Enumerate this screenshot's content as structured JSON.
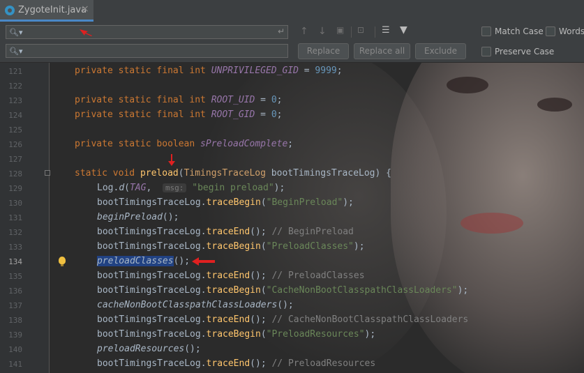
{
  "tab": {
    "filename": "ZygoteInit.java",
    "close": "×"
  },
  "find": {
    "search_placeholder": "",
    "replace_placeholder": "",
    "buttons": {
      "replace": "Replace",
      "replace_all": "Replace all",
      "exclude": "Exclude"
    },
    "options": {
      "match_case": "Match Case",
      "words": "Words",
      "preserve_case": "Preserve Case"
    }
  },
  "editor": {
    "current_line": 134,
    "lines": [
      {
        "n": "121"
      },
      {
        "n": "122"
      },
      {
        "n": "123"
      },
      {
        "n": "124"
      },
      {
        "n": "125"
      },
      {
        "n": "126"
      },
      {
        "n": "127"
      },
      {
        "n": "128"
      },
      {
        "n": "129"
      },
      {
        "n": "130"
      },
      {
        "n": "131"
      },
      {
        "n": "132"
      },
      {
        "n": "133"
      },
      {
        "n": "134"
      },
      {
        "n": "135"
      },
      {
        "n": "136"
      },
      {
        "n": "137"
      },
      {
        "n": "138"
      },
      {
        "n": "139"
      },
      {
        "n": "140"
      },
      {
        "n": "141"
      }
    ],
    "tokens": {
      "private": "private",
      "static": "static",
      "final": "final",
      "int": "int",
      "boolean": "boolean",
      "void": "void",
      "unprivileged_gid": "UNPRIVILEGED_GID",
      "v9999": "9999",
      "root_uid": "ROOT_UID",
      "root_gid": "ROOT_GID",
      "zero": "0",
      "spreload": "sPreloadComplete",
      "preload": "preload",
      "timings_cls": "TimingsTraceLog",
      "param": "bootTimingsTraceLog",
      "log": "Log",
      "d": "d",
      "tag": "TAG",
      "msg_hint": "msg:",
      "begin_preload_str": "\"begin preload\"",
      "obj": "bootTimingsTraceLog",
      "traceBegin": "traceBegin",
      "traceEnd": "traceEnd",
      "s_beginpreload": "\"BeginPreload\"",
      "beginPreload": "beginPreload",
      "c_beginpreload": "// BeginPreload",
      "s_preloadclasses": "\"PreloadClasses\"",
      "preloadClasses": "preloadClasses",
      "c_preloadclasses": "// PreloadClasses",
      "s_cachenonboot": "\"CacheNonBootClasspathClassLoaders\"",
      "cacheNonBoot": "cacheNonBootClasspathClassLoaders",
      "c_cachenonboot": "// CacheNonBootClasspathClassLoaders",
      "s_preloadresources": "\"PreloadResources\"",
      "preloadResources": "preloadResources",
      "c_preloadresources": "// PreloadResources"
    }
  }
}
